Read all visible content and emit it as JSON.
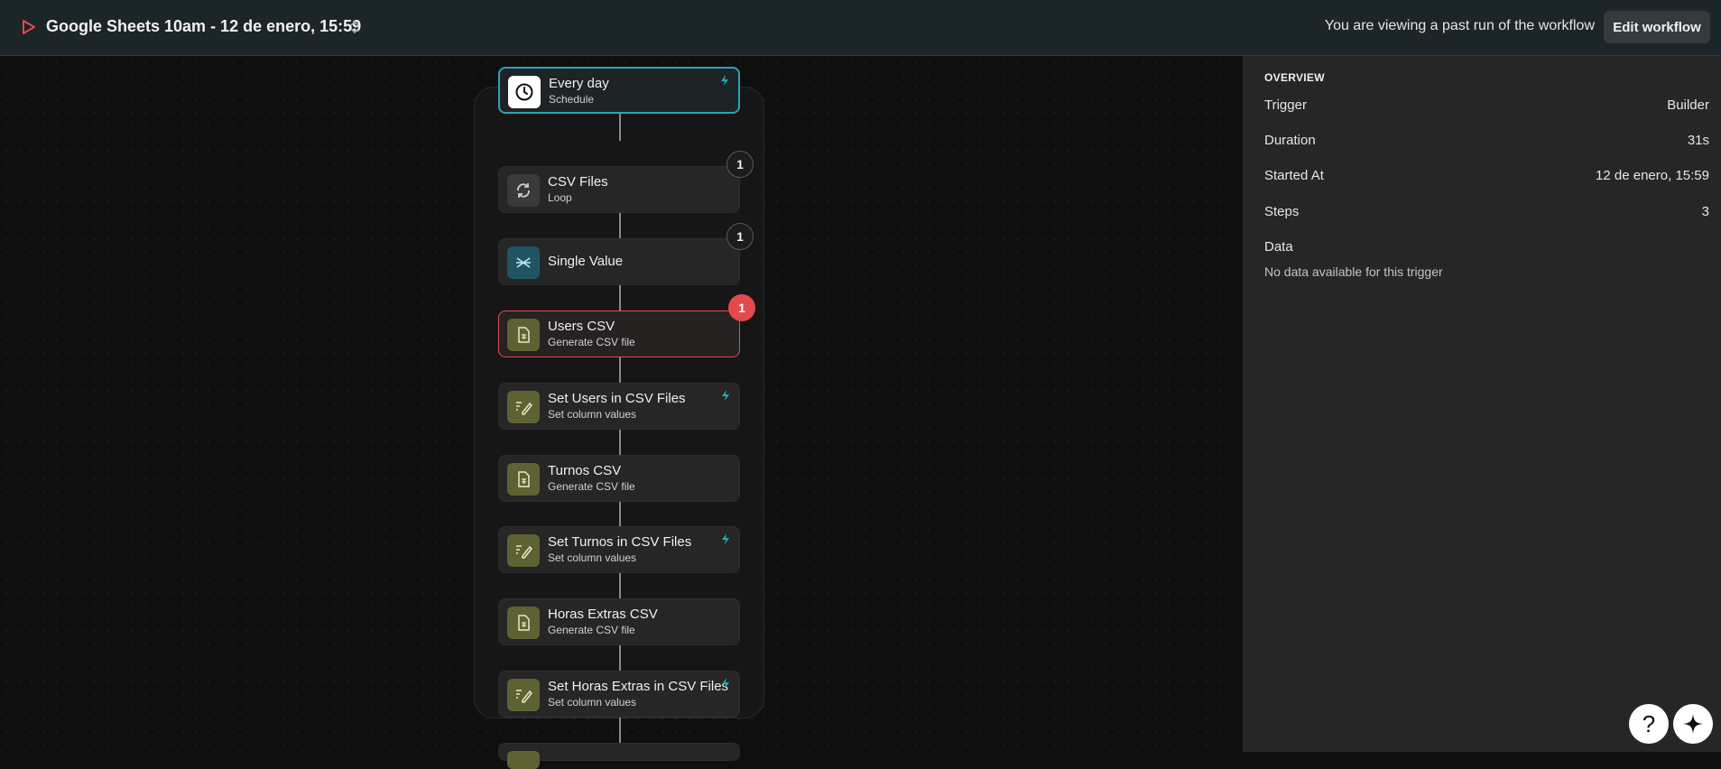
{
  "header": {
    "run_title": "Google Sheets 10am - 12 de enero, 15:59",
    "past_run_text": "You are viewing a past run of the workflow",
    "edit_button": "Edit workflow"
  },
  "workflow": {
    "trigger": {
      "title": "Every day",
      "subtitle": "Schedule",
      "icon": "clock-icon"
    },
    "loop": {
      "title": "CSV Files",
      "subtitle": "Loop",
      "icon": "loop-icon",
      "badge": "1"
    },
    "nodes": [
      {
        "title": "Single Value",
        "subtitle": "",
        "icon": "asterisk-icon",
        "badge": "1"
      },
      {
        "title": "Users CSV",
        "subtitle": "Generate CSV file",
        "icon": "csv-file-icon",
        "badge": "1",
        "status": "error"
      },
      {
        "title": "Set Users in CSV Files",
        "subtitle": "Set column values",
        "icon": "edit-lines-icon"
      },
      {
        "title": "Turnos CSV",
        "subtitle": "Generate CSV file",
        "icon": "csv-file-icon"
      },
      {
        "title": "Set Turnos in CSV Files",
        "subtitle": "Set column values",
        "icon": "edit-lines-icon"
      },
      {
        "title": "Horas Extras CSV",
        "subtitle": "Generate CSV file",
        "icon": "csv-file-icon"
      },
      {
        "title": "Set Horas Extras in CSV Files",
        "subtitle": "Set column values",
        "icon": "edit-lines-icon"
      }
    ]
  },
  "overview": {
    "heading": "OVERVIEW",
    "rows": [
      {
        "label": "Trigger",
        "value": "Builder"
      },
      {
        "label": "Duration",
        "value": "31s"
      },
      {
        "label": "Started At",
        "value": "12 de enero, 15:59"
      },
      {
        "label": "Steps",
        "value": "3"
      }
    ],
    "data_label": "Data",
    "no_data": "No data available for this trigger"
  },
  "fabs": {
    "help": "?",
    "assistant_icon": "sparkle-icon"
  },
  "colors": {
    "accent": "#2aa5b8",
    "error": "#e5484d",
    "olive_icon": "#5e6233",
    "run_icon": "#e5484d"
  }
}
